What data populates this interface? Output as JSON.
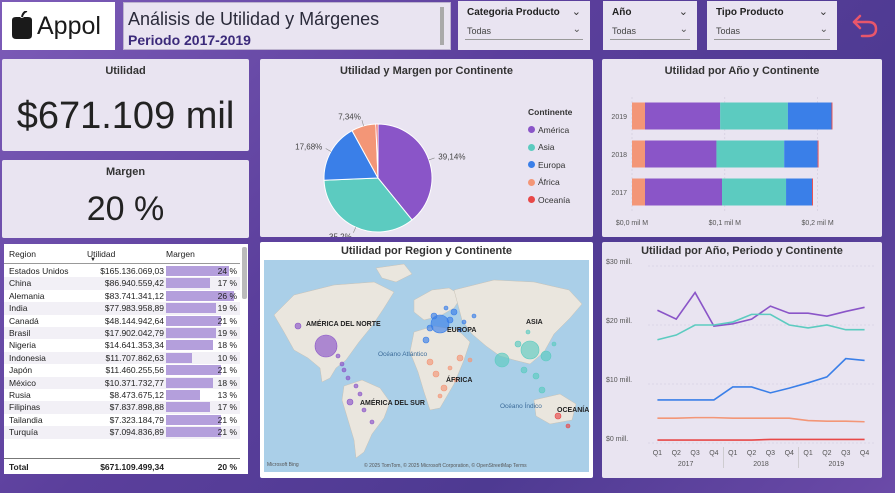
{
  "header": {
    "logo_text": "Appol",
    "title": "Análisis de Utilidad y Márgenes",
    "subtitle": "Periodo 2017-2019"
  },
  "slicers": [
    {
      "label": "Categoria Producto",
      "value": "Todas"
    },
    {
      "label": "Año",
      "value": "Todas"
    },
    {
      "label": "Tipo Producto",
      "value": "Todas"
    }
  ],
  "kpi": {
    "utilidad_label": "Utilidad",
    "utilidad_value": "$671.109 mil",
    "margen_label": "Margen",
    "margen_value": "20 %"
  },
  "colors": {
    "america": "#8a55c8",
    "asia": "#5ccbc0",
    "europa": "#3a7fe8",
    "africa": "#f39677",
    "oceania": "#e84848",
    "accent": "#e8566b"
  },
  "table": {
    "headers": [
      "Region",
      "Utilidad",
      "Margen"
    ],
    "rows": [
      {
        "region": "Estados Unidos",
        "utilidad": "$165.136.069,03",
        "margen": "24 %",
        "m": 24
      },
      {
        "region": "China",
        "utilidad": "$86.940.559,42",
        "margen": "17 %",
        "m": 17
      },
      {
        "region": "Alemania",
        "utilidad": "$83.741.341,12",
        "margen": "26 %",
        "m": 26
      },
      {
        "region": "India",
        "utilidad": "$77.983.958,89",
        "margen": "19 %",
        "m": 19
      },
      {
        "region": "Canadá",
        "utilidad": "$48.144.942,64",
        "margen": "21 %",
        "m": 21
      },
      {
        "region": "Brasil",
        "utilidad": "$17.902.042,79",
        "margen": "19 %",
        "m": 19
      },
      {
        "region": "Nigeria",
        "utilidad": "$14.641.353,34",
        "margen": "18 %",
        "m": 18
      },
      {
        "region": "Indonesia",
        "utilidad": "$11.707.862,63",
        "margen": "10 %",
        "m": 10
      },
      {
        "region": "Japón",
        "utilidad": "$11.460.255,56",
        "margen": "21 %",
        "m": 21
      },
      {
        "region": "México",
        "utilidad": "$10.371.732,77",
        "margen": "18 %",
        "m": 18
      },
      {
        "region": "Rusia",
        "utilidad": "$8.473.675,12",
        "margen": "13 %",
        "m": 13
      },
      {
        "region": "Filipinas",
        "utilidad": "$7.837.898,88",
        "margen": "17 %",
        "m": 17
      },
      {
        "region": "Tailandia",
        "utilidad": "$7.323.184,79",
        "margen": "21 %",
        "m": 21
      },
      {
        "region": "Turquía",
        "utilidad": "$7.094.836,89",
        "margen": "21 %",
        "m": 21
      }
    ],
    "total_label": "Total",
    "total_utilidad": "$671.109.499,34",
    "total_margen": "20 %"
  },
  "map": {
    "title": "Utilidad por Region y Continente",
    "labels": [
      "AMÉRICA DEL NORTE",
      "EUROPA",
      "ASIA",
      "ÁFRICA",
      "AMÉRICA DEL SUR",
      "OCEANÍA",
      "Océano Atlántico",
      "Océano Índico"
    ],
    "footer": "© 2025 TomTom, © 2025 Microsoft Corporation, © OpenStreetMap  Terms",
    "brand": "Microsoft Bing"
  },
  "chart_data": [
    {
      "type": "pie",
      "title": "Utilidad y Margen por Continente",
      "legend_title": "Continente",
      "categories": [
        "América",
        "Asia",
        "Europa",
        "África",
        "Oceanía"
      ],
      "values": [
        39.14,
        35.2,
        17.68,
        7.34,
        0.64
      ],
      "data_labels": [
        "39,14%",
        "35,2%",
        "17,68%",
        "7,34%",
        ""
      ],
      "legend_position": "right"
    },
    {
      "type": "bar",
      "orientation": "horizontal",
      "stacked": true,
      "title": "Utilidad por Año y Continente",
      "categories": [
        "2019",
        "2018",
        "2017"
      ],
      "series": [
        {
          "name": "África",
          "values": [
            0.014,
            0.014,
            0.014
          ]
        },
        {
          "name": "América",
          "values": [
            0.081,
            0.077,
            0.083
          ]
        },
        {
          "name": "Asia",
          "values": [
            0.073,
            0.073,
            0.069
          ]
        },
        {
          "name": "Europa",
          "values": [
            0.047,
            0.036,
            0.028
          ]
        },
        {
          "name": "Oceanía",
          "values": [
            0.001,
            0.001,
            0.001
          ]
        }
      ],
      "xticks": [
        "$0,0 mil M",
        "$0,1 mil M",
        "$0,2 mil M"
      ],
      "xlim": [
        0,
        0.25
      ]
    },
    {
      "type": "line",
      "title": "Utilidad por Año, Periodo y Continente",
      "x": [
        "Q1",
        "Q2",
        "Q3",
        "Q4",
        "Q1",
        "Q2",
        "Q3",
        "Q4",
        "Q1",
        "Q2",
        "Q3",
        "Q4"
      ],
      "year_labels": [
        "2017",
        "2018",
        "2019"
      ],
      "yticks": [
        "$0 mill.",
        "$10 mill.",
        "$20 mill.",
        "$30 mill."
      ],
      "ylim": [
        0,
        30
      ],
      "series": [
        {
          "name": "América",
          "values": [
            22.5,
            21,
            25.5,
            19.8,
            20.2,
            21,
            23.2,
            22,
            22,
            21.5,
            22.3,
            23
          ]
        },
        {
          "name": "Asia",
          "values": [
            17.5,
            18.3,
            20,
            20,
            20.5,
            21.8,
            21.8,
            20,
            19.5,
            20,
            19.2,
            19.2
          ]
        },
        {
          "name": "Europa",
          "values": [
            7.3,
            7.3,
            7.3,
            7.3,
            9.5,
            9.5,
            8.5,
            9.3,
            10.2,
            11.2,
            14.3,
            14
          ]
        },
        {
          "name": "África",
          "values": [
            4.2,
            4.2,
            4.3,
            4.3,
            4.2,
            4.2,
            4.2,
            4.2,
            3.8,
            3.7,
            3.7,
            3.6
          ]
        },
        {
          "name": "Oceanía",
          "values": [
            0.5,
            0.5,
            0.5,
            0.5,
            0.5,
            0.5,
            0.6,
            0.6,
            0.6,
            0.6,
            0.6,
            0.6
          ]
        }
      ]
    }
  ]
}
